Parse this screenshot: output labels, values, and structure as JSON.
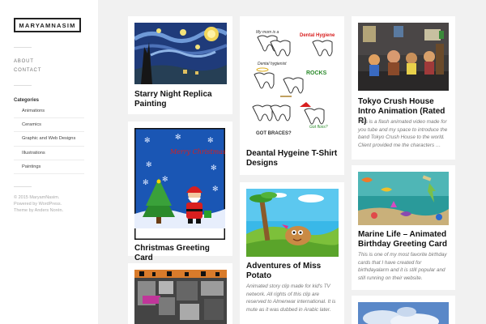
{
  "site": {
    "title": "MARYAMNASIM"
  },
  "nav": [
    "ABOUT",
    "CONTACT"
  ],
  "categories": {
    "title": "Categories",
    "items": [
      "Animations",
      "Ceramics",
      "Graphic and Web Designs",
      "Illustrations",
      "Paintings"
    ]
  },
  "credits": [
    "© 2015 MaryamNasim.",
    "Powered by WordPress.",
    "Theme by Anders Norén."
  ],
  "posts": [
    {
      "title": "Starry Night Replica Painting"
    },
    {
      "title": "Christmas Greeting Card",
      "image_text": "Merry Christmas"
    },
    {
      "title": "Deantal Hygeine T-Shirt Designs",
      "image_text": [
        "My mom is a",
        "Dental hygienist",
        "Dental Hygiene",
        "ROCKS",
        "GOT BRACES?",
        "Got floss?"
      ]
    },
    {
      "title": "Adventures of Miss Potato",
      "excerpt": "Animated story clip made for kid's TV network. All rights of this clip are reserved to Almenwar international. It is mute as it was dubbed in Arabic later."
    },
    {
      "title": "Tokyo Crush House Intro Animation (Rated R)",
      "excerpt": "This is a flash animated video made for you tube and my space to introduce the band Tokyo Crush House to the world. Client provided me the characters …"
    },
    {
      "title": "Marine Life – Animated Birthday Greeting Card",
      "excerpt": "This is one of my most favorite birthday cards that I have created for birthdayalarm and it is still popular and still running on their website."
    }
  ]
}
